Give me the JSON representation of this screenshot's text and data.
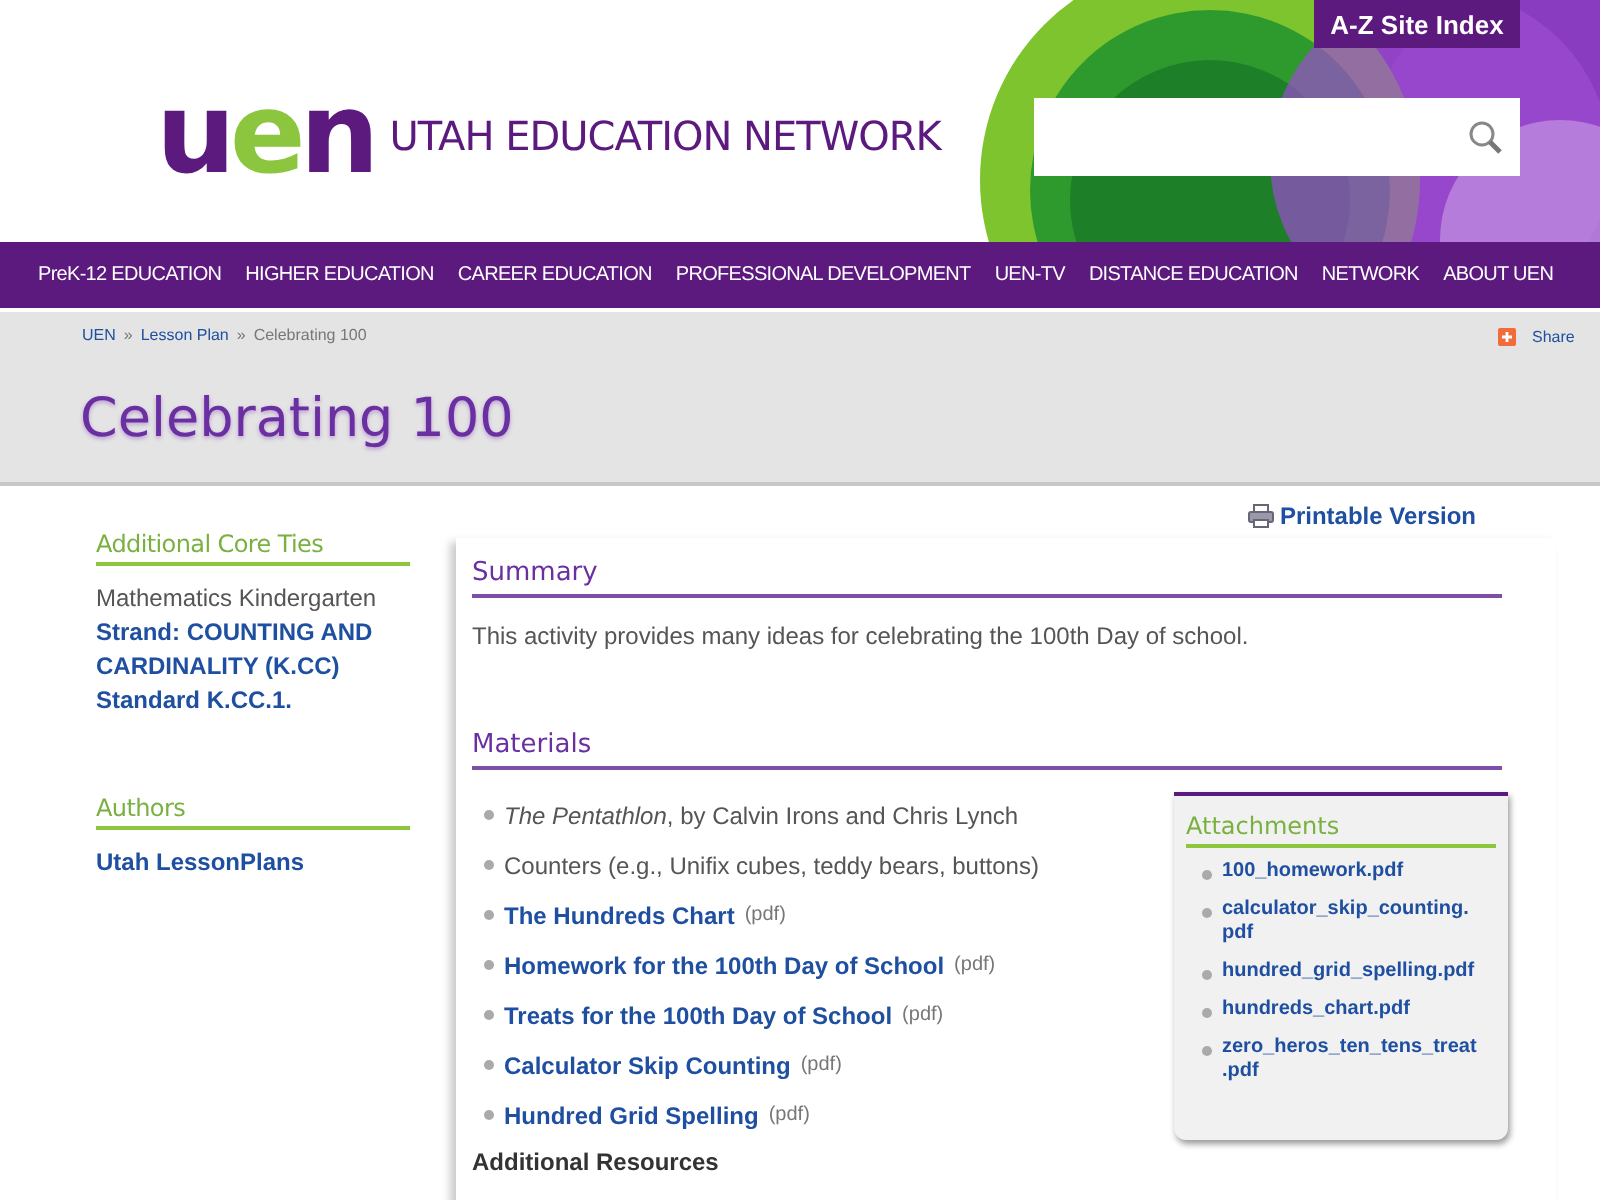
{
  "header": {
    "site_index": "A-Z Site Index",
    "logo_letters": [
      "u",
      "e",
      "n"
    ],
    "site_name": "UTAH EDUCATION NETWORK"
  },
  "nav": [
    "PreK-12 EDUCATION",
    "HIGHER EDUCATION",
    "CAREER EDUCATION",
    "PROFESSIONAL DEVELOPMENT",
    "UEN-TV",
    "DISTANCE EDUCATION",
    "NETWORK",
    "ABOUT UEN"
  ],
  "breadcrumb": [
    {
      "label": "UEN",
      "kind": "link"
    },
    {
      "label": "Lesson Plan",
      "kind": "link"
    },
    {
      "label": "Celebrating 100",
      "kind": "current"
    }
  ],
  "breadcrumb_separator": "»",
  "share": "Share",
  "page_title": "Celebrating 100",
  "sidebar": [
    {
      "heading": "Additional Core Ties",
      "items": [
        {
          "text": "Mathematics Kindergarten",
          "kind": "text"
        },
        {
          "text": "Strand: COUNTING AND CARDINALITY (K.CC)",
          "kind": "link"
        },
        {
          "text": "Standard K.CC.1.",
          "kind": "link"
        }
      ]
    },
    {
      "heading": "Authors",
      "items": [
        {
          "text": "Utah LessonPlans",
          "kind": "link"
        }
      ]
    }
  ],
  "printable": "Printable Version",
  "summary": {
    "heading": "Summary",
    "text": "This activity provides many ideas for celebrating the 100th Day of school."
  },
  "materials": {
    "heading": "Materials",
    "items": [
      {
        "kind": "text",
        "text": "*The Pentathlon*, by Calvin Irons and Chris Lynch"
      },
      {
        "kind": "text",
        "text": "Counters (e.g., Unifix cubes, teddy bears, buttons)"
      },
      {
        "kind": "link",
        "text": "The Hundreds Chart",
        "suffix": "(pdf)"
      },
      {
        "kind": "link",
        "text": "Homework for the 100th Day of School",
        "suffix": "(pdf)"
      },
      {
        "kind": "link",
        "text": "Treats for the 100th Day of School",
        "suffix": "(pdf)"
      },
      {
        "kind": "link",
        "text": "Calculator Skip Counting",
        "suffix": "(pdf)"
      },
      {
        "kind": "link",
        "text": "Hundred Grid Spelling",
        "suffix": "(pdf)"
      }
    ]
  },
  "attachments": {
    "heading": "Attachments",
    "items": [
      "100_homework.pdf",
      "calculator_skip_counting.\npdf",
      "hundred_grid_spelling.pdf",
      "hundreds_chart.pdf",
      "zero_heros_ten_tens_treat\n.pdf"
    ]
  },
  "additional_resources": "Additional Resources"
}
